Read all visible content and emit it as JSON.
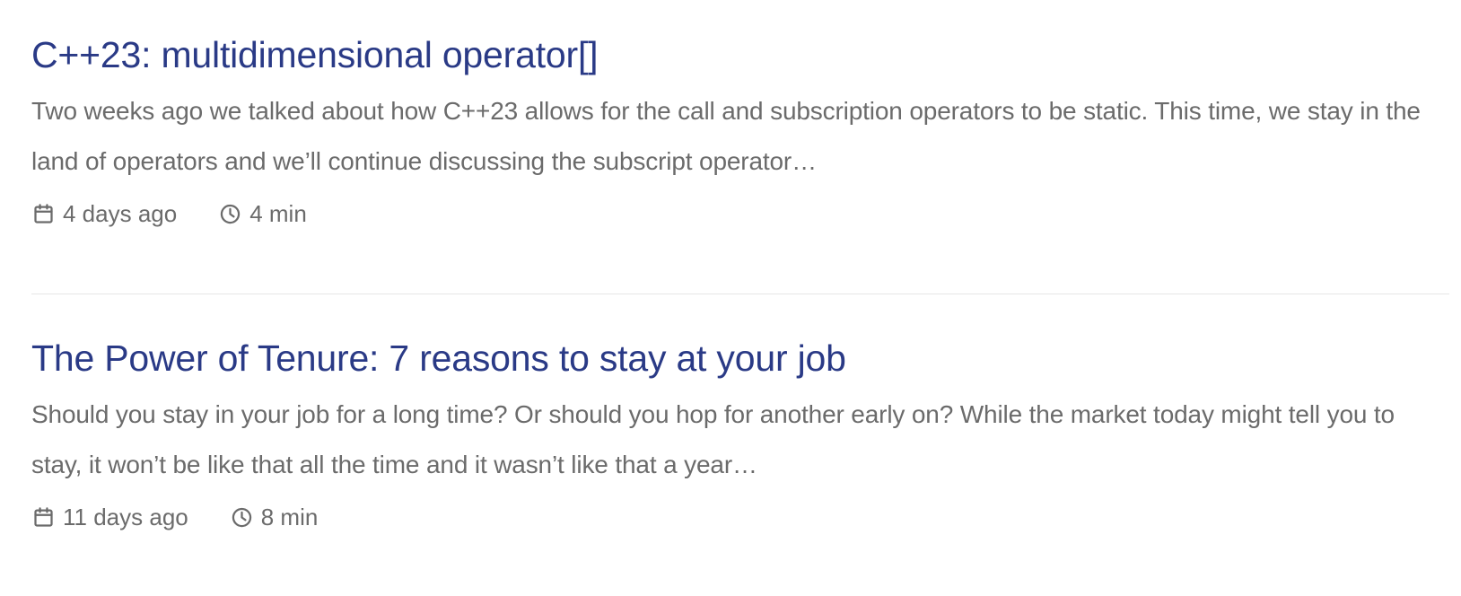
{
  "posts": [
    {
      "title": "C++23: multidimensional operator[]",
      "excerpt": "Two weeks ago we talked about how C++23 allows for the call and subscription operators to be static. This time, we stay in the land of operators and we’ll continue discussing the subscript operator…",
      "date": "4 days ago",
      "reading_time": "4 min",
      "date_icon": "calendar-icon",
      "time_icon": "clock-icon"
    },
    {
      "title": "The Power of Tenure: 7 reasons to stay at your job",
      "excerpt": "Should you stay in your job for a long time? Or should you hop for another early on? While the market today might tell you to stay, it won’t be like that all the time and it wasn’t like that a year…",
      "date": "11 days ago",
      "reading_time": "8 min",
      "date_icon": "calendar-icon",
      "time_icon": "clock-icon"
    }
  ],
  "colors": {
    "title": "#2a3a86",
    "body_text": "#6b6b6b",
    "divider": "#e6e6e6",
    "background": "#ffffff"
  }
}
